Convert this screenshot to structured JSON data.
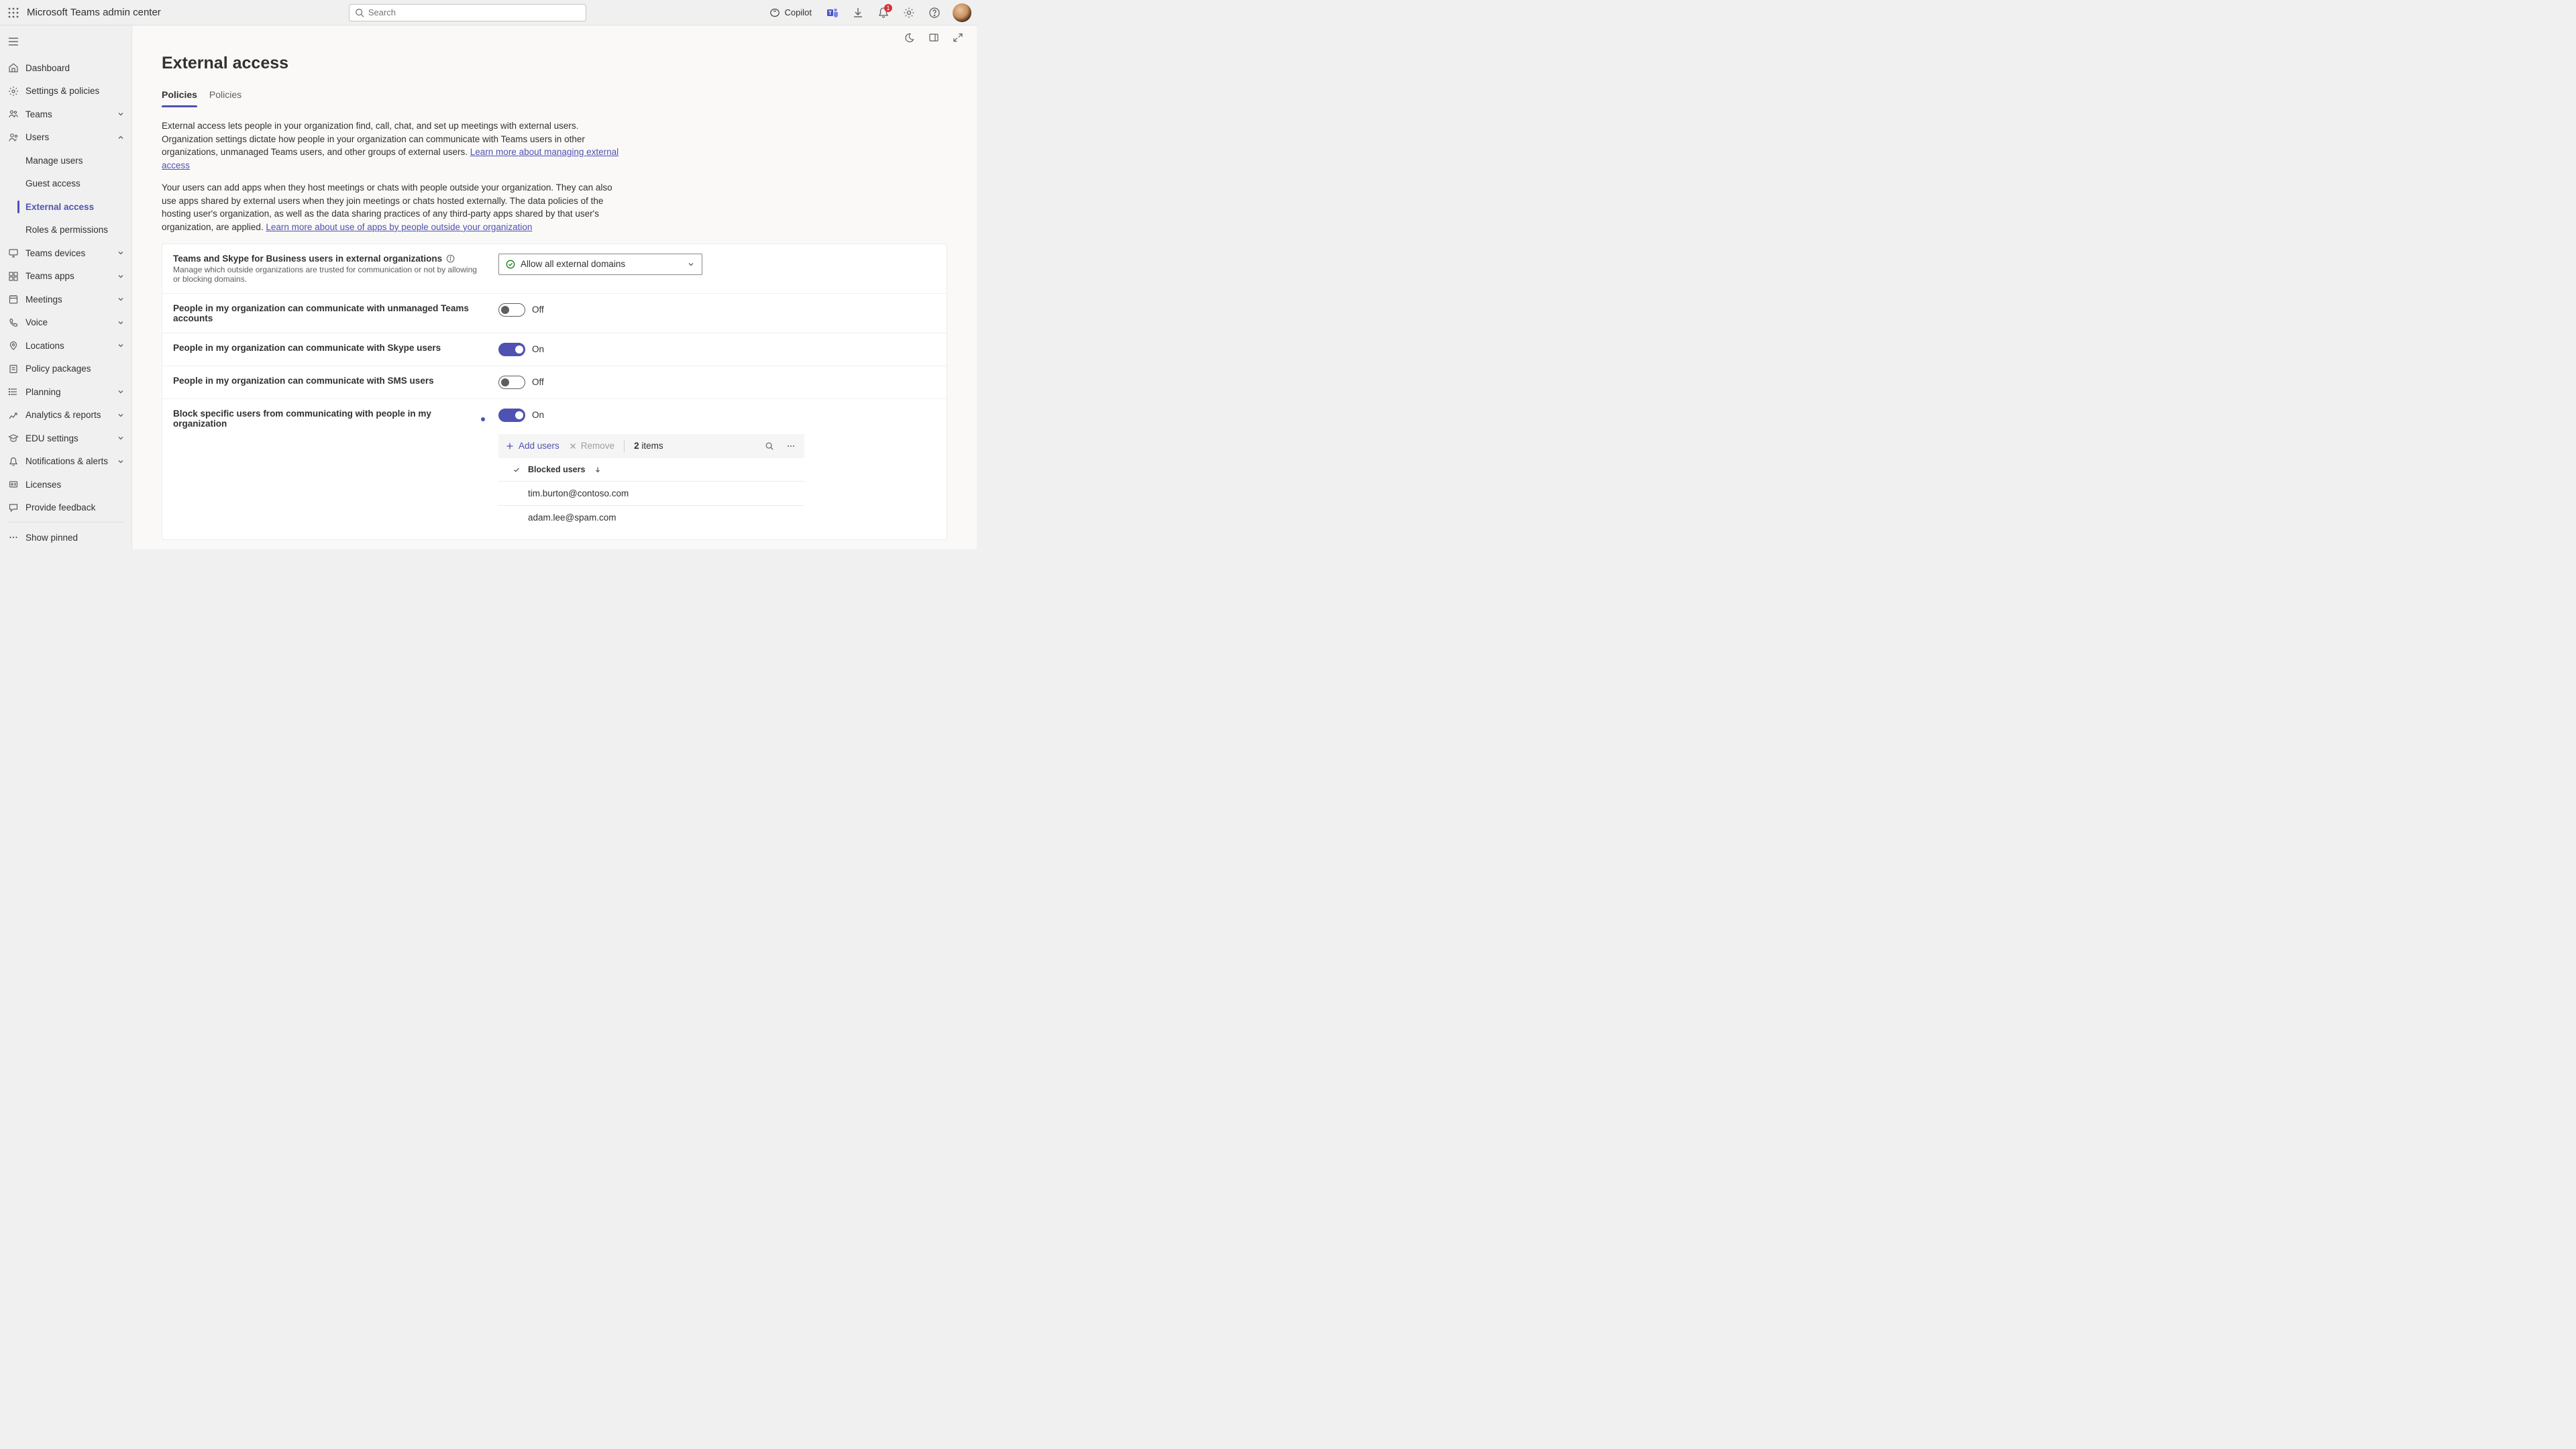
{
  "app": {
    "title": "Microsoft Teams admin center"
  },
  "search": {
    "placeholder": "Search"
  },
  "topbar": {
    "copilot_label": "Copilot",
    "notification_count": "1"
  },
  "content_toolbar": {},
  "sidebar": {
    "items": [
      {
        "label": "Dashboard"
      },
      {
        "label": "Settings & policies"
      },
      {
        "label": "Teams",
        "chev": true
      },
      {
        "label": "Users",
        "chev": true,
        "expanded": true,
        "children": [
          {
            "label": "Manage users"
          },
          {
            "label": "Guest access"
          },
          {
            "label": "External access",
            "active": true
          },
          {
            "label": "Roles & permissions"
          }
        ]
      },
      {
        "label": "Teams devices",
        "chev": true
      },
      {
        "label": "Teams apps",
        "chev": true
      },
      {
        "label": "Meetings",
        "chev": true
      },
      {
        "label": "Voice",
        "chev": true
      },
      {
        "label": "Locations",
        "chev": true
      },
      {
        "label": "Policy packages"
      },
      {
        "label": "Planning",
        "chev": true
      },
      {
        "label": "Analytics & reports",
        "chev": true
      },
      {
        "label": "EDU settings",
        "chev": true
      },
      {
        "label": "Notifications & alerts",
        "chev": true
      },
      {
        "label": "Licenses"
      },
      {
        "label": "Provide feedback"
      }
    ],
    "footer": {
      "show_pinned": "Show pinned"
    }
  },
  "page": {
    "title": "External access",
    "tabs": [
      "Policies",
      "Policies"
    ],
    "intro1_a": "External access lets people in your organization find, call, chat, and set up meetings with external users. Organization settings dictate how people in your organization can communicate with Teams users in other organizations, unmanaged Teams users, and other groups of external users. ",
    "intro1_link": "Learn more about managing external access",
    "intro2_a": "Your users can add apps when they host meetings or chats with people outside your organization. They can also use apps shared by external users when they join meetings or chats hosted externally. The data policies of the hosting user's organization, as well as the data sharing practices of any third-party apps shared by that user's organization, are applied. ",
    "intro2_link": "Learn more about use of apps by people outside your organization"
  },
  "settings": {
    "row_domain": {
      "title": "Teams and Skype for Business users in external organizations",
      "sub": "Manage which outside organizations are trusted for communication or not by allowing or blocking domains.",
      "value": "Allow all external domains"
    },
    "row_unmanaged": {
      "title": "People in my organization can communicate with unmanaged Teams accounts",
      "state": "Off",
      "on": false
    },
    "row_skype": {
      "title": "People in my organization can communicate with Skype users",
      "state": "On",
      "on": true
    },
    "row_sms": {
      "title": "People in my organization can communicate with SMS users",
      "state": "Off",
      "on": false
    },
    "row_block": {
      "title": "Block specific users from communicating with people in my organization",
      "state": "On",
      "on": true
    }
  },
  "blocked_table": {
    "add_label": "Add users",
    "remove_label": "Remove",
    "count_num": "2",
    "count_suffix": " items",
    "col_name": "Blocked users",
    "rows": [
      {
        "email": "tim.burton@contoso.com"
      },
      {
        "email": "adam.lee@spam.com"
      }
    ]
  }
}
